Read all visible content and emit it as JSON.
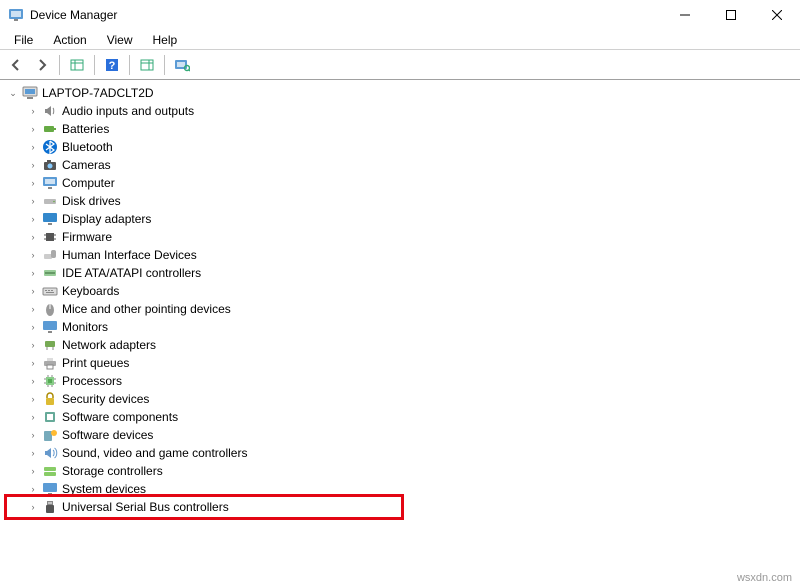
{
  "window": {
    "title": "Device Manager"
  },
  "menu": {
    "file": "File",
    "action": "Action",
    "view": "View",
    "help": "Help"
  },
  "tree": {
    "root": "LAPTOP-7ADCLT2D",
    "items": [
      "Audio inputs and outputs",
      "Batteries",
      "Bluetooth",
      "Cameras",
      "Computer",
      "Disk drives",
      "Display adapters",
      "Firmware",
      "Human Interface Devices",
      "IDE ATA/ATAPI controllers",
      "Keyboards",
      "Mice and other pointing devices",
      "Monitors",
      "Network adapters",
      "Print queues",
      "Processors",
      "Security devices",
      "Software components",
      "Software devices",
      "Sound, video and game controllers",
      "Storage controllers",
      "System devices",
      "Universal Serial Bus controllers"
    ]
  },
  "watermark": "wsxdn.com"
}
